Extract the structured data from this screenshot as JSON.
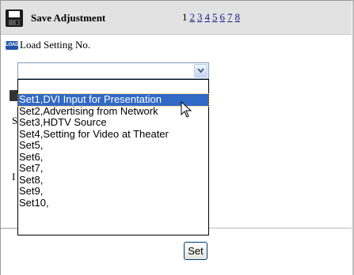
{
  "header": {
    "title": "Save Adjustment",
    "pages": [
      {
        "label": "1",
        "link": false
      },
      {
        "label": "2",
        "link": true
      },
      {
        "label": "3",
        "link": true
      },
      {
        "label": "4",
        "link": true
      },
      {
        "label": "5",
        "link": true
      },
      {
        "label": "6",
        "link": true
      },
      {
        "label": "7",
        "link": true
      },
      {
        "label": "8",
        "link": true
      }
    ]
  },
  "load": {
    "icon_text": "LOAD",
    "label": "Load Setting No."
  },
  "dropdown": {
    "selected_value": "",
    "options": [
      "",
      "Set1,DVI Input for Presentation",
      "Set2,Advertising from Network",
      "Set3,HDTV Source",
      "Set4,Setting for Video at Theater",
      "Set5,",
      "Set6,",
      "Set7,",
      "Set8,",
      "Set9,",
      "Set10,"
    ],
    "highlighted_index": 1
  },
  "background_fragments": {
    "s": "S",
    "l": "I"
  },
  "actions": {
    "set_label": "Set"
  }
}
